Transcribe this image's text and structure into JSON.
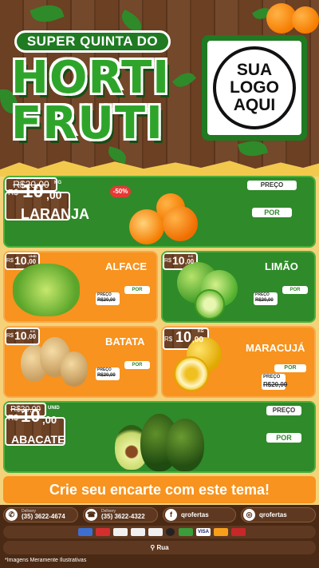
{
  "header": {
    "banner": "SUPER QUINTA DO",
    "title_line1": "HORTI",
    "title_line2": "FRUTI"
  },
  "logo": {
    "line1": "SUA",
    "line2": "LOGO",
    "line3": "AQUI"
  },
  "products": [
    {
      "name": "LARANJA",
      "badge": "-50%",
      "preco_label": "PREÇO",
      "old_price": "R$20,00",
      "por_label": "POR",
      "currency": "R$",
      "price_int": "10",
      "price_cents": ",00",
      "unit": "KG"
    },
    {
      "name": "ALFACE",
      "preco_label": "PREÇO",
      "old_price": "R$20,00",
      "por_label": "POR",
      "currency": "R$",
      "price_int": "10",
      "price_cents": ",00",
      "unit": "UNID"
    },
    {
      "name": "LIMÃO",
      "preco_label": "PREÇO",
      "old_price": "R$20,00",
      "por_label": "POR",
      "currency": "R$",
      "price_int": "10",
      "price_cents": ",00",
      "unit": "KG"
    },
    {
      "name": "BATATA",
      "preco_label": "PREÇO",
      "old_price": "R$20,00",
      "por_label": "POR",
      "currency": "R$",
      "price_int": "10",
      "price_cents": ",00",
      "unit": "KG"
    },
    {
      "name": "MARACUJÁ",
      "preco_label": "PREÇO",
      "old_price": "R$20,00",
      "por_label": "POR",
      "currency": "R$",
      "price_int": "10",
      "price_cents": ",00",
      "unit": "KG"
    },
    {
      "name": "ABACATE",
      "preco_label": "PREÇO",
      "old_price": "R$20,00",
      "por_label": "POR",
      "currency": "R$",
      "price_int": "10",
      "price_cents": ",00",
      "unit": "UNID"
    }
  ],
  "cta": "Crie seu encarte com este tema!",
  "footer": {
    "contacts": [
      {
        "icon": "whatsapp-icon",
        "label": "Delivery",
        "value": "(35) 3622-4674"
      },
      {
        "icon": "phone-icon",
        "label": "Delivery",
        "value": "(35) 3622-4322"
      },
      {
        "icon": "facebook-icon",
        "value": "qrofertas"
      },
      {
        "icon": "instagram-icon",
        "value": "qrofertas"
      }
    ],
    "payments": [
      "card-1",
      "card-2",
      "card-3",
      "card-4",
      "card-5",
      "card-6",
      "card-7",
      "visa",
      "mastercard",
      "hipercard"
    ],
    "address": "Rua"
  },
  "disclaimer": "*Imagens Meramente Ilustrativas",
  "colors": {
    "green": "#2f8a2a",
    "orange": "#f7931e",
    "wood": "#6b4023",
    "red": "#e53935"
  }
}
